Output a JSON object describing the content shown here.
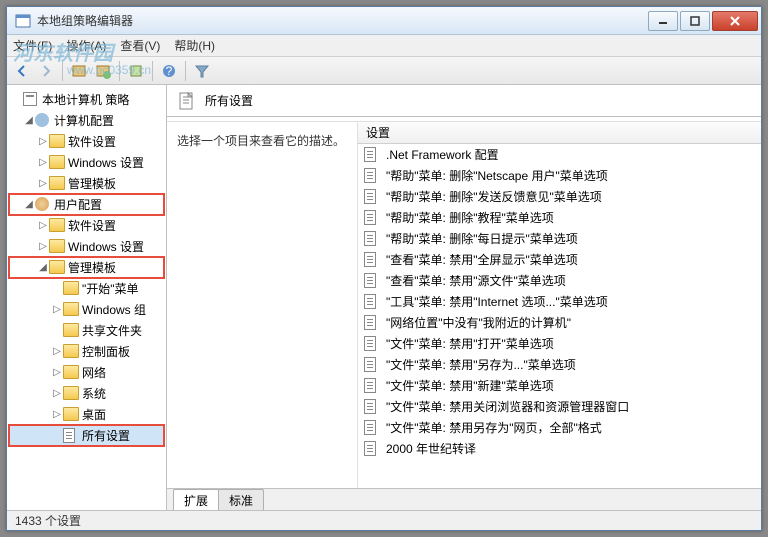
{
  "window": {
    "title": "本地组策略编辑器"
  },
  "menubar": {
    "file": "文件(F)",
    "action": "操作(A)",
    "view": "查看(V)",
    "help": "帮助(H)"
  },
  "watermark": {
    "brand": "河东软件园",
    "url": "www.pc0359.cn"
  },
  "tree": {
    "root": "本地计算机 策略",
    "computer": "计算机配置",
    "comp_soft": "软件设置",
    "comp_win": "Windows 设置",
    "comp_admin": "管理模板",
    "user": "用户配置",
    "user_soft": "软件设置",
    "user_win": "Windows 设置",
    "user_admin": "管理模板",
    "start": "\"开始\"菜单",
    "win_comp": "Windows 组",
    "shared": "共享文件夹",
    "ctrl": "控制面板",
    "network": "网络",
    "system": "系统",
    "desktop": "桌面",
    "all_settings": "所有设置"
  },
  "right": {
    "title": "所有设置",
    "prompt": "选择一个项目来查看它的描述。",
    "column": "设置",
    "items": [
      ".Net Framework 配置",
      "\"帮助\"菜单: 删除\"Netscape 用户\"菜单选项",
      "\"帮助\"菜单: 删除\"发送反馈意见\"菜单选项",
      "\"帮助\"菜单: 删除\"教程\"菜单选项",
      "\"帮助\"菜单: 删除\"每日提示\"菜单选项",
      "\"查看\"菜单: 禁用\"全屏显示\"菜单选项",
      "\"查看\"菜单: 禁用\"源文件\"菜单选项",
      "\"工具\"菜单: 禁用\"Internet 选项...\"菜单选项",
      "\"网络位置\"中没有\"我附近的计算机\"",
      "\"文件\"菜单: 禁用\"打开\"菜单选项",
      "\"文件\"菜单: 禁用\"另存为...\"菜单选项",
      "\"文件\"菜单: 禁用\"新建\"菜单选项",
      "\"文件\"菜单: 禁用关闭浏览器和资源管理器窗口",
      "\"文件\"菜单: 禁用另存为\"网页，全部\"格式",
      "2000 年世纪转译"
    ]
  },
  "tabs": {
    "extended": "扩展",
    "standard": "标准"
  },
  "statusbar": {
    "text": "1433 个设置"
  }
}
